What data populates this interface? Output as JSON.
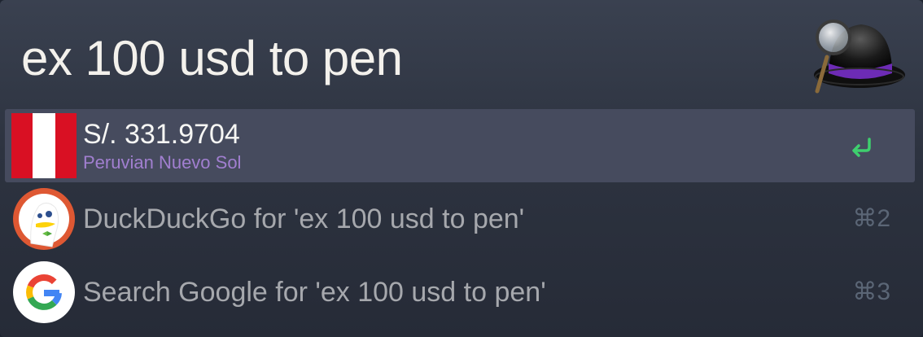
{
  "search": {
    "query": "ex 100 usd to pen"
  },
  "app": {
    "logo": "alfred-hat-icon"
  },
  "results": [
    {
      "title": "S/. 331.9704",
      "subtitle": "Peruvian Nuevo Sol",
      "icon": "peru-flag-icon",
      "action_icon": "return-key-icon",
      "selected": true
    },
    {
      "title": "DuckDuckGo for 'ex 100 usd to pen'",
      "icon": "duckduckgo-icon",
      "shortcut": "⌘2"
    },
    {
      "title": "Search Google for 'ex 100 usd to pen'",
      "icon": "google-icon",
      "shortcut": "⌘3"
    }
  ],
  "colors": {
    "subtitle": "#a17fd0",
    "selected_row": "#464b5e",
    "return_icon": "#3ecf6e",
    "flag_red": "#d91023"
  }
}
